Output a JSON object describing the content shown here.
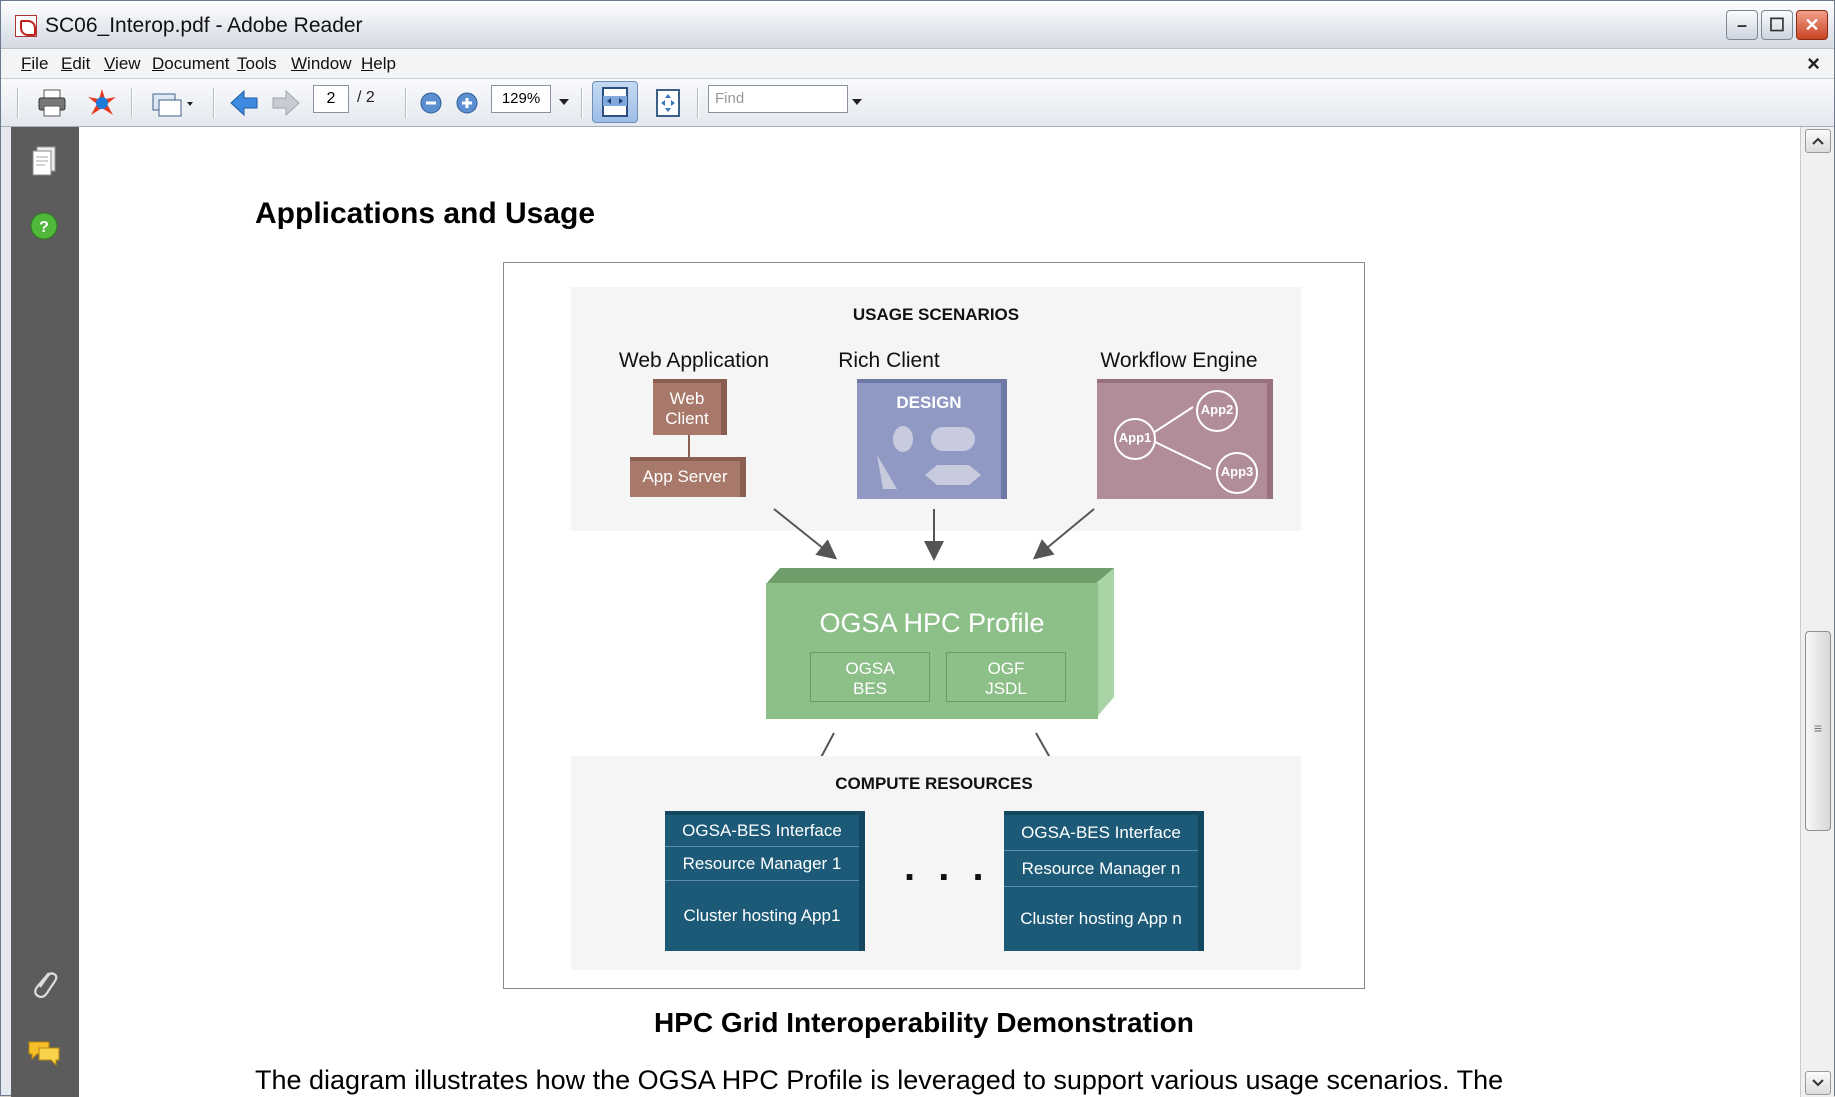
{
  "window": {
    "title": "SC06_Interop.pdf - Adobe Reader",
    "minimize_glyph": "–",
    "maximize_glyph": "☐",
    "close_glyph": "✕"
  },
  "menu": {
    "items": [
      {
        "label": "File",
        "underline": "F",
        "rest": "ile"
      },
      {
        "label": "Edit",
        "underline": "E",
        "rest": "dit"
      },
      {
        "label": "View",
        "underline": "V",
        "rest": "iew"
      },
      {
        "label": "Document",
        "underline": "D",
        "rest": "ocument"
      },
      {
        "label": "Tools",
        "underline": "T",
        "rest": "ools"
      },
      {
        "label": "Window",
        "underline": "W",
        "rest": "indow"
      },
      {
        "label": "Help",
        "underline": "H",
        "rest": "elp"
      }
    ],
    "doc_close": "×"
  },
  "toolbar": {
    "current_page": "2",
    "page_total": "/ 2",
    "zoom": "129%",
    "find_placeholder": "Find",
    "icons": [
      "print-icon",
      "collaborate-icon",
      "select-tool-icon",
      "previous-page-icon",
      "next-page-icon",
      "zoom-out-icon",
      "zoom-in-icon",
      "fit-width-icon",
      "fit-page-icon"
    ]
  },
  "navpane": {
    "icons": [
      "pages-icon",
      "help-icon",
      "attachments-icon",
      "comments-icon"
    ]
  },
  "document": {
    "heading": "Applications and Usage",
    "caption": "HPC Grid Interoperability Demonstration",
    "body_text": "The diagram illustrates how the OGSA HPC Profile is leveraged to support various usage scenarios. The"
  },
  "diagram": {
    "usage_title": "USAGE SCENARIOS",
    "scenarios": [
      {
        "name": "Web Application"
      },
      {
        "name": "Rich Client"
      },
      {
        "name": "Workflow Engine"
      }
    ],
    "web_client": "Web\nClient",
    "web_client_line1": "Web",
    "web_client_line2": "Client",
    "app_server": "App Server",
    "design": "DESIGN",
    "workflow_nodes": [
      "App1",
      "App2",
      "App3"
    ],
    "profile_title": "OGSA HPC Profile",
    "profile_sub": [
      {
        "line1": "OGSA",
        "line2": "BES"
      },
      {
        "line1": "OGF",
        "line2": "JSDL"
      }
    ],
    "compute_title": "COMPUTE RESOURCES",
    "resources": [
      {
        "interface": "OGSA-BES Interface",
        "manager": "Resource Manager 1",
        "cluster": "Cluster hosting App1"
      },
      {
        "interface": "OGSA-BES Interface",
        "manager": "Resource Manager n",
        "cluster": "Cluster hosting App n"
      }
    ],
    "ellipsis": ". . ."
  },
  "colors": {
    "web_box": "#a8796a",
    "design_box": "#8f99c4",
    "workflow_box": "#b08d97",
    "profile_box": "#8dbf88",
    "resource_box": "#1d5a78"
  }
}
